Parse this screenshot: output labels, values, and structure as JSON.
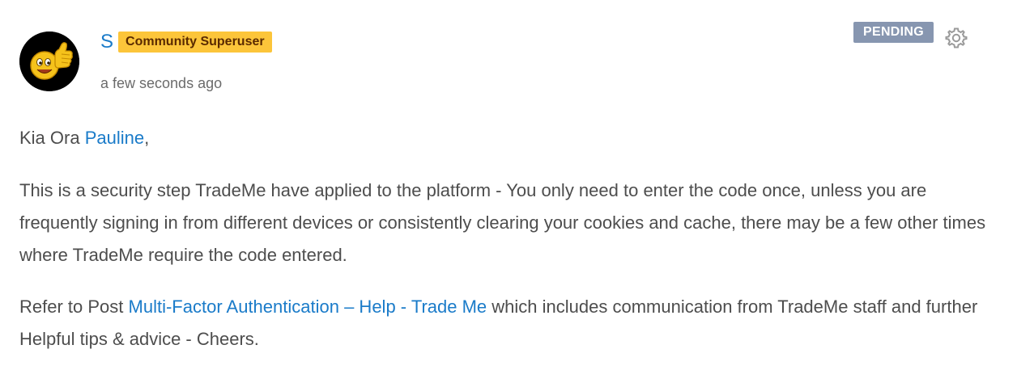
{
  "post": {
    "author": {
      "name": "S",
      "rank": "Community Superuser"
    },
    "timestamp": "a few seconds ago",
    "status": "PENDING",
    "body": {
      "greeting_prefix": "Kia Ora ",
      "mention": "Pauline",
      "greeting_suffix": ",",
      "paragraph_main": "This is a security step TradeMe have applied to the platform - You only need to enter the code once, unless you are frequently signing in from different devices or consistently clearing your cookies and cache, there may be a few other times where TradeMe require the code entered.",
      "refer_prefix": "Refer to Post ",
      "refer_link": "Multi-Factor Authentication – Help - Trade Me",
      "refer_suffix": " which includes communication from TradeMe staff and further Helpful tips & advice - Cheers."
    },
    "icons": {
      "avatar": "thumbs-up-smiley-avatar",
      "options": "gear-icon"
    },
    "colors": {
      "link": "#1a7bc9",
      "rank_badge": "#fcc53a",
      "pending_badge": "#8796b0"
    }
  }
}
